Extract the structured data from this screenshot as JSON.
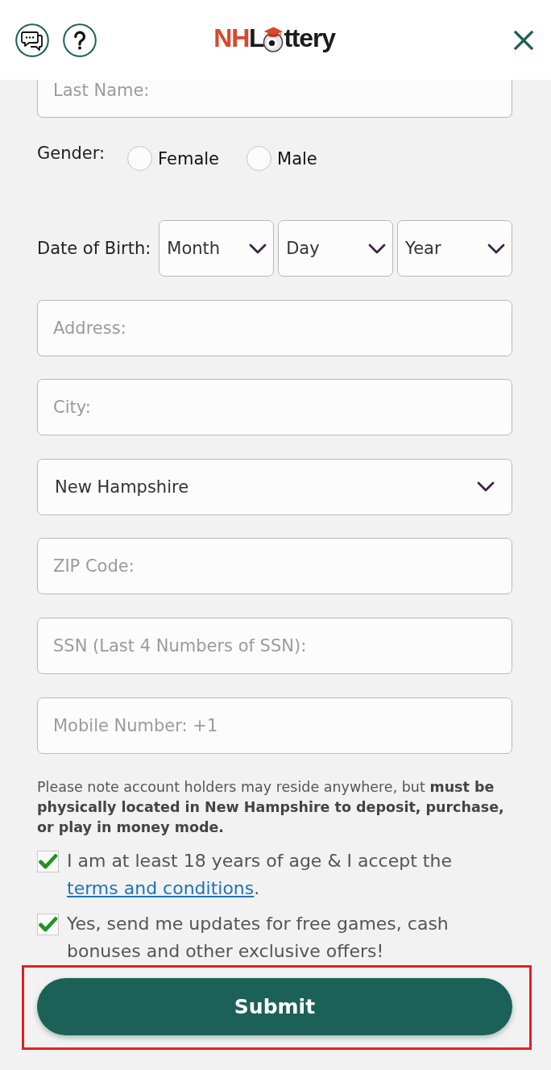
{
  "logo": {
    "colored_text": "NH",
    "dark_text": "L",
    "tail_text": "ttery"
  },
  "form": {
    "rows": [
      {
        "kind": "text",
        "placeholder": "Last Name:"
      },
      {
        "kind": "radio",
        "label": "Gender:",
        "options": [
          {
            "label": "Female",
            "selected": false
          },
          {
            "label": "Male",
            "selected": false
          }
        ]
      },
      {
        "kind": "date",
        "label": "Date of Birth:",
        "selects": [
          {
            "value": "Month"
          },
          {
            "value": "Day"
          },
          {
            "value": "Year"
          }
        ]
      },
      {
        "kind": "text",
        "placeholder": "Address:"
      },
      {
        "kind": "text",
        "placeholder": "City:"
      },
      {
        "kind": "select",
        "value": "New Hampshire"
      },
      {
        "kind": "text",
        "placeholder": "ZIP Code:"
      },
      {
        "kind": "text",
        "placeholder": "SSN (Last 4 Numbers of SSN):"
      },
      {
        "kind": "text",
        "placeholder": "Mobile Number: +1"
      }
    ],
    "note": "Please note account holders may reside anywhere, but **must be physically located in New Hampshire to deposit, purchase, or play in money mode.**",
    "consents": [
      {
        "checked": true,
        "text": "I am at least 18 years of age & I accept the",
        "link": "terms and conditions",
        "after_link": "."
      },
      {
        "checked": true,
        "text": "Yes, send me updates for free games, cash bonuses and other exclusive offers!"
      }
    ],
    "submit": {
      "label": "Submit",
      "highlighted": true
    }
  }
}
